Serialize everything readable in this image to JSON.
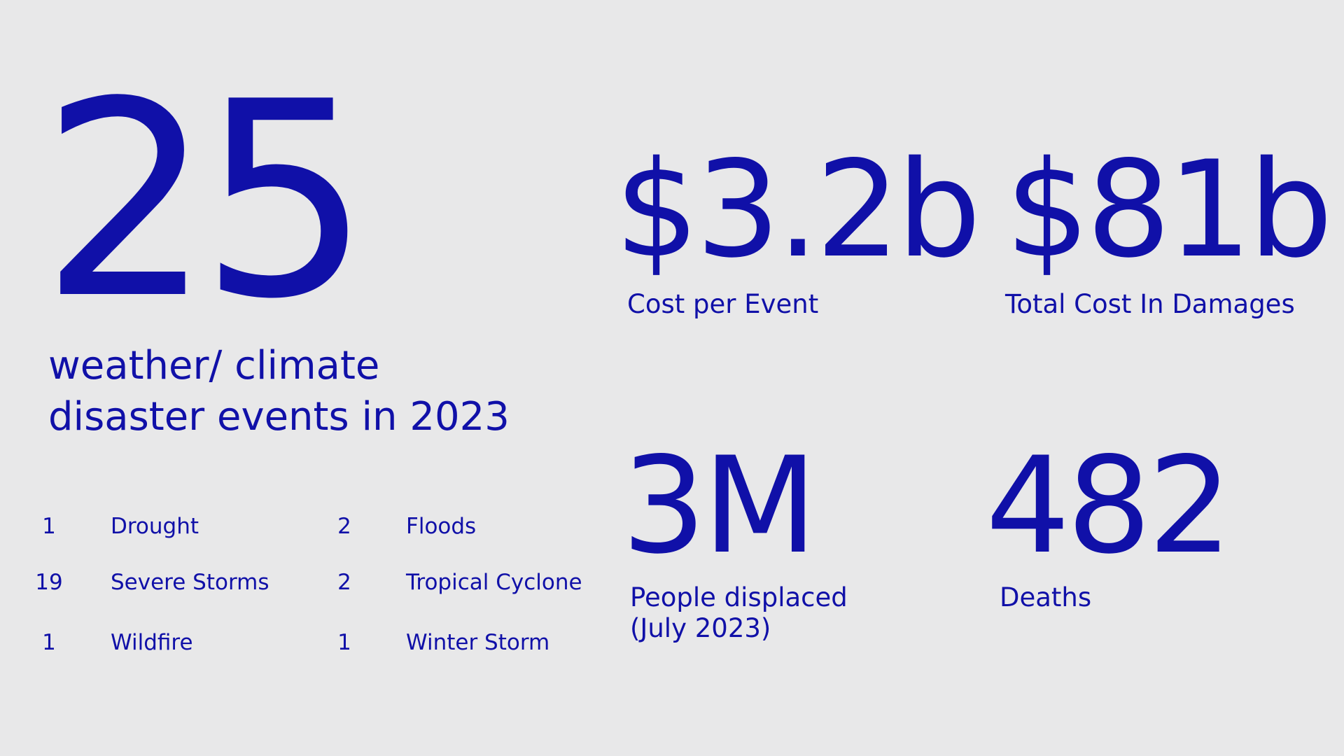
{
  "headline": {
    "number": "25",
    "caption_line_1": "weather/ climate",
    "caption_line_2": "disaster events in 2023"
  },
  "breakdown": [
    {
      "count": "1",
      "label": "Drought"
    },
    {
      "count": "19",
      "label": "Severe Storms"
    },
    {
      "count": "1",
      "label": "Wildfire"
    },
    {
      "count": "2",
      "label": "Floods"
    },
    {
      "count": "2",
      "label": "Tropical Cyclone"
    },
    {
      "count": "1",
      "label": "Winter Storm"
    }
  ],
  "stats": {
    "cost_per_event": {
      "value": "$3.2b",
      "label": "Cost per Event"
    },
    "total_cost": {
      "value": "$81b",
      "label": "Total Cost In Damages"
    },
    "displaced": {
      "value": "3M",
      "label_line_1": "People displaced",
      "label_line_2": "(July 2023)"
    },
    "deaths": {
      "value": "482",
      "label": "Deaths"
    }
  },
  "colors": {
    "background": "#e8e8e9",
    "text": "#1010a8"
  }
}
